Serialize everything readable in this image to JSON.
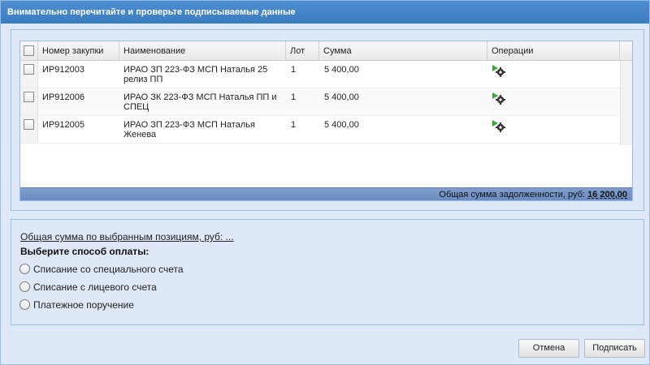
{
  "window": {
    "title": "Внимательно перечитайте и проверьте подписываемые данные"
  },
  "grid": {
    "columns": [
      "Номер закупки",
      "Наименование",
      "Лот",
      "Сумма",
      "Операции"
    ],
    "rows": [
      {
        "number": "ИР912003",
        "name_line1": "ИРАО ЗП 223-ФЗ МСП Наталья 25",
        "name_line2": "релиз ПП",
        "lot": "1",
        "sum": "5 400,00",
        "op_icon": "gear-settings-icon"
      },
      {
        "number": "ИР912006",
        "name_line1": "ИРАО ЗК 223-ФЗ МСП Наталья ПП и",
        "name_line2": "СПЕЦ",
        "lot": "1",
        "sum": "5 400,00",
        "op_icon": "gear-settings-icon"
      },
      {
        "number": "ИР912005",
        "name_line1": "ИРАО ЗП 223-ФЗ МСП Наталья",
        "name_line2": "Женева",
        "lot": "1",
        "sum": "5 400,00",
        "op_icon": "gear-settings-icon"
      }
    ],
    "footer_label": "Общая сумма задолженности, руб:",
    "footer_total": "16 200,00"
  },
  "payment": {
    "selected_sum_label": "Общая сумма по выбранным позициям, руб: ...",
    "method_label": "Выберите способ оплаты:",
    "options": [
      "Списание со специального счета",
      "Списание с лицевого счета",
      "Платежное поручение"
    ]
  },
  "buttons": {
    "cancel": "Отмена",
    "sign": "Подписать"
  },
  "colors": {
    "titlebar": "#3f82c6",
    "panel_bg": "#dfe8f6",
    "panel_border": "#99bbe8",
    "footer_bar": "#7293c7"
  }
}
